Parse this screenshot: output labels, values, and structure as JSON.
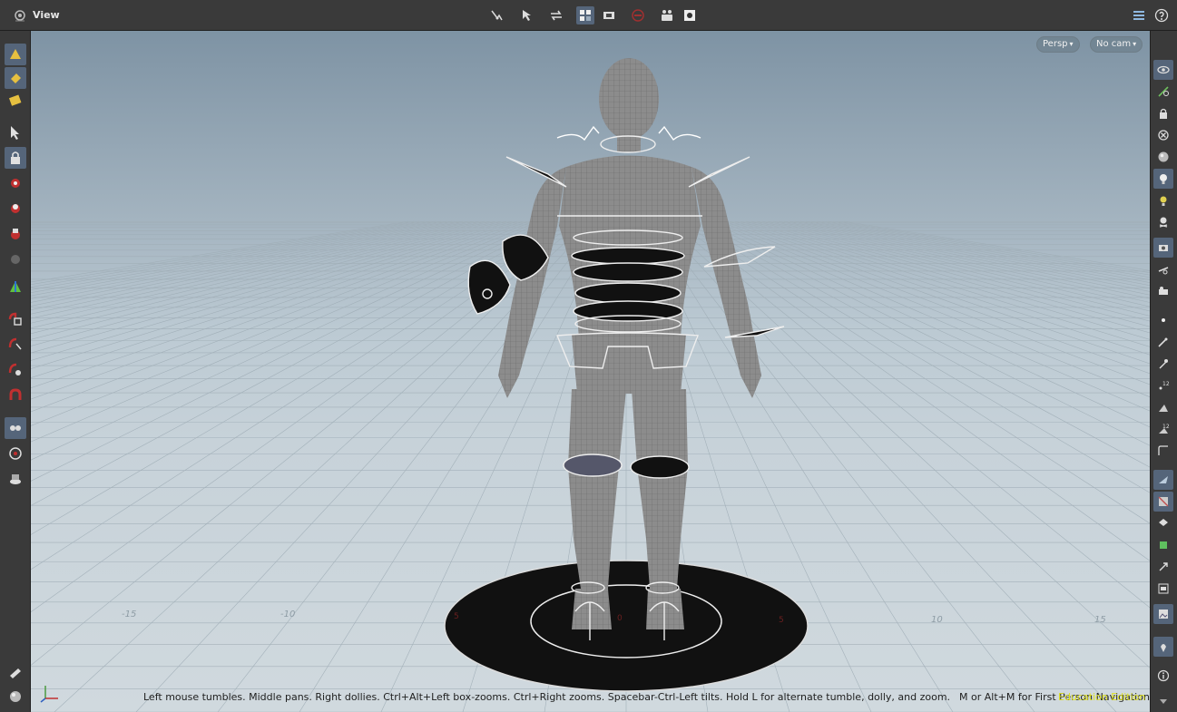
{
  "pane": {
    "title": "View",
    "title_icon": "viewport-icon"
  },
  "top_toolbar": [
    {
      "name": "pose-handle-icon",
      "active": false
    },
    {
      "name": "select-arrow-icon",
      "active": false
    },
    {
      "name": "transform-icon",
      "active": false
    },
    {
      "name": "snapping-icon",
      "active": true
    },
    {
      "name": "camera-icon",
      "active": false
    },
    {
      "name": "no-entry-icon",
      "active": false
    },
    {
      "name": "flipbook-icon",
      "active": false
    },
    {
      "name": "render-icon",
      "active": false
    }
  ],
  "top_right_toolbar": [
    {
      "name": "display-options-icon"
    },
    {
      "name": "help-icon"
    }
  ],
  "viewport_menus": {
    "projection": "Persp",
    "camera": "No cam"
  },
  "status": {
    "hint": "Left mouse tumbles. Middle pans. Right dollies. Ctrl+Alt+Left box-zooms. Ctrl+Right zooms. Spacebar-Ctrl-Left tilts. Hold L for alternate tumble, dolly, and zoom.",
    "hint2": "M or Alt+M for First Person Navigation.",
    "edition": "Education Edition"
  },
  "grid_labels": {
    "neg15": "-15",
    "neg10": "-10",
    "pos10": "10",
    "pos15": "15",
    "disc_left": "5",
    "disc_right": "5",
    "disc_center": "0"
  },
  "colors": {
    "active_tool": "#55657a",
    "toolbar_bg": "#3a3a3a",
    "edition_text": "#e0e020"
  }
}
